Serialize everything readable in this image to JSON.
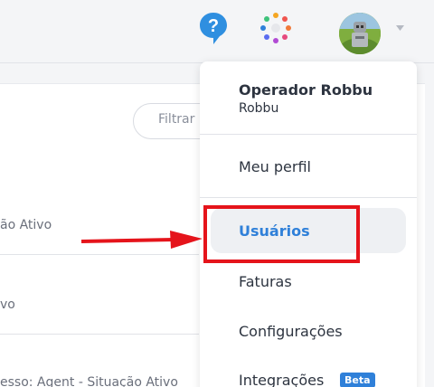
{
  "header": {
    "icons": [
      "help-icon",
      "apps-icon",
      "avatar",
      "chevron-down-icon"
    ],
    "accent_color": "#2f80d9"
  },
  "background": {
    "filter_label": "Filtrar",
    "rows": [
      "ão Ativo",
      "vo",
      "esso: Agent  - Situação Ativo"
    ]
  },
  "dropdown": {
    "user_name": "Operador Robbu",
    "company": "Robbu",
    "items": [
      {
        "label": "Meu perfil"
      },
      {
        "label": "Usuários",
        "active": true
      },
      {
        "label": "Faturas"
      },
      {
        "label": "Configurações"
      },
      {
        "label": "Integrações",
        "badge": "Beta"
      }
    ]
  },
  "annotation": {
    "highlight_color": "#e5141b"
  }
}
